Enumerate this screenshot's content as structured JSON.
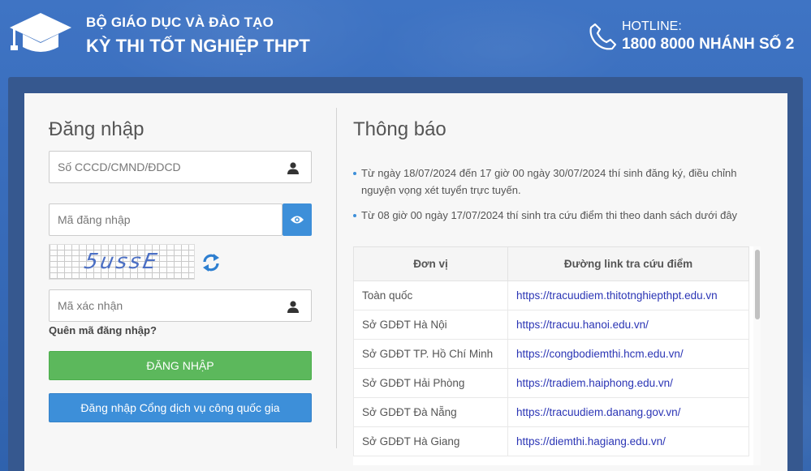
{
  "header": {
    "org": "BỘ GIÁO DỤC VÀ ĐÀO TẠO",
    "exam": "KỲ THI TỐT NGHIỆP THPT",
    "hotline_label": "HOTLINE:",
    "hotline_number": "1800 8000 NHÁNH SỐ 2",
    "logo_icon": "graduation-cap-icon",
    "phone_icon": "phone-icon"
  },
  "login": {
    "title": "Đăng nhập",
    "id_placeholder": "Số CCCD/CMND/ĐDCD",
    "code_placeholder": "Mã đăng nhập",
    "captcha_text": "5ussE",
    "verify_placeholder": "Mã xác nhận",
    "forgot_label": "Quên mã đăng nhập?",
    "login_button": "ĐĂNG NHẬP",
    "portal_button": "Đăng nhập Cổng dịch vụ công quốc gia"
  },
  "notice": {
    "title": "Thông báo",
    "items": [
      "Từ ngày 18/07/2024 đến 17 giờ 00 ngày 30/07/2024 thí sinh đăng ký, điều chỉnh nguyện vọng xét tuyển trực tuyến.",
      "Từ 08 giờ 00 ngày 17/07/2024 thí sinh tra cứu điểm thi theo danh sách dưới đây"
    ],
    "table": {
      "headers": [
        "Đơn vị",
        "Đường link tra cứu điểm"
      ],
      "rows": [
        {
          "unit": "Toàn quốc",
          "link": "https://tracuudiem.thitotnghiepthpt.edu.vn"
        },
        {
          "unit": "Sở GDĐT Hà Nội",
          "link": "https://tracuu.hanoi.edu.vn/"
        },
        {
          "unit": "Sở GDĐT TP. Hồ Chí Minh",
          "link": "https://congbodiemthi.hcm.edu.vn/"
        },
        {
          "unit": "Sở GDĐT Hải Phòng",
          "link": "https://tradiem.haiphong.edu.vn/"
        },
        {
          "unit": "Sở GDĐT Đà Nẵng",
          "link": "https://tracuudiem.danang.gov.vn/"
        },
        {
          "unit": "Sở GDĐT Hà Giang",
          "link": "https://diemthi.hagiang.edu.vn/"
        }
      ]
    }
  },
  "colors": {
    "background": "#3a6ebd",
    "login_button": "#5cb85c",
    "primary_button": "#3d8fd9",
    "link": "#2b35b5"
  }
}
